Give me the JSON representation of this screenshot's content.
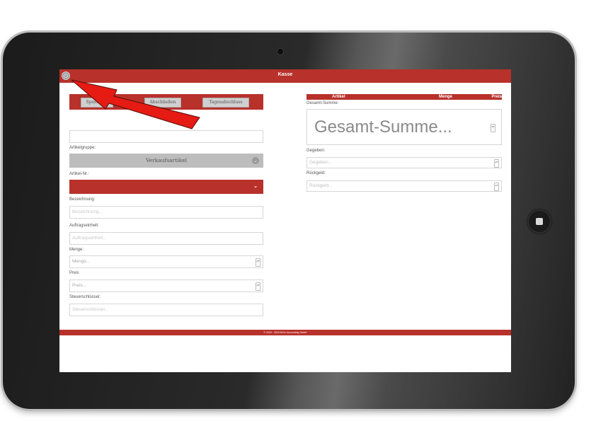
{
  "app": {
    "title": "Kasse"
  },
  "toolbar": {
    "save_label": "Speichern",
    "close_label": "Abschließen",
    "day_close_label": "Tagesabschluss"
  },
  "form": {
    "group_label": "Artikelgruppe:",
    "group_value": "Verkaufsartikel",
    "article_no_label": "Artikel-Nr.:",
    "name_label": "Bezeichnung:",
    "name_placeholder": "Bezeichnung...",
    "unit_label": "Auftragseinheit:",
    "unit_placeholder": "Auftragseinheit...",
    "qty_label": "Menge:",
    "qty_placeholder": "Menge...",
    "price_label": "Preis",
    "price_placeholder": "Preis...",
    "tax_label": "Steuerschlüssel:",
    "tax_placeholder": "Steuerschlüssel..."
  },
  "cart": {
    "col_article": "Artikel",
    "col_qty": "Menge",
    "col_price": "Preis",
    "total_label": "Gesamt-Summe:",
    "total_placeholder": "Gesamt-Summe...",
    "given_label": "Gegeben:",
    "given_placeholder": "Gegeben...",
    "change_label": "Rückgeld:",
    "change_placeholder": "Rückgeld..."
  },
  "footer": {
    "text": "© 2019 - 2020 All for Accounting GmbH"
  },
  "colors": {
    "accent": "#b8312b",
    "arrow": "#e51b14"
  },
  "icons": {
    "power": "power-icon",
    "chevron": "chevron-down-icon",
    "spinner": "spinner-icon"
  }
}
